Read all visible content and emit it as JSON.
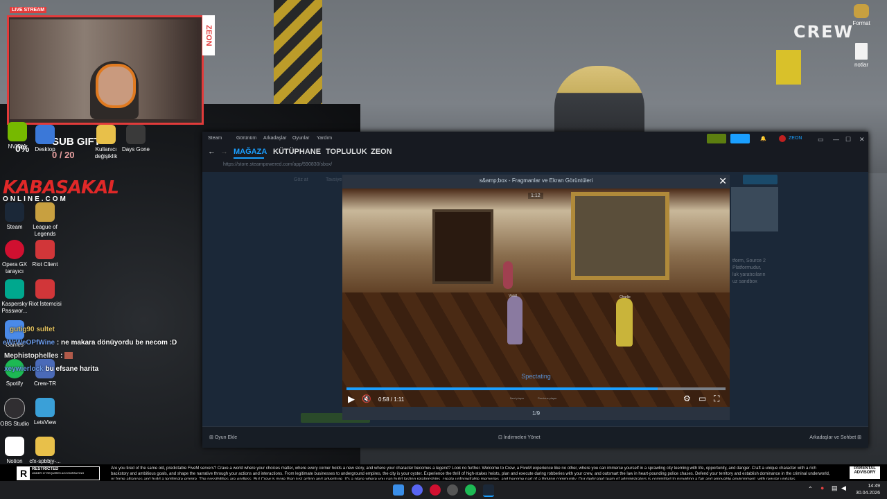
{
  "overlay": {
    "live_stream": "LIVE STREAM",
    "zeon_vertical": "ZEON",
    "percent": "0%",
    "sub_gift": "SUB GIFT",
    "gift_count": "0 / 20",
    "kabasakal": "KABASAKAL",
    "online": "ONLINE.COM",
    "crew_logo": "CREW"
  },
  "desktop_icons": [
    {
      "label": "NVIDIA",
      "color": "#76b900"
    },
    {
      "label": "Desktop",
      "color": "#3b78d8"
    },
    {
      "label": "Kullanıcı değişiklik",
      "color": "#e8c04a"
    },
    {
      "label": "Days Gone",
      "color": "#3a3a3a"
    },
    {
      "label": "Steam",
      "color": "#1b2838"
    },
    {
      "label": "League of Legends",
      "color": "#c8a040"
    },
    {
      "label": "Opera GX tarayıcı",
      "color": "#d01030"
    },
    {
      "label": "Riot Client",
      "color": "#d13639"
    },
    {
      "label": "Kaspersky Passwor...",
      "color": "#00a88e"
    },
    {
      "label": "Riot İstemcisi",
      "color": "#d13639"
    },
    {
      "label": "Games",
      "color": "#4a8ae8"
    },
    {
      "label": "Spotify",
      "color": "#1db954"
    },
    {
      "label": "Crew-TR",
      "color": "#4a6ab8"
    },
    {
      "label": "OBS Studio",
      "color": "#302e31"
    },
    {
      "label": "LetsView",
      "color": "#3aa0d8"
    },
    {
      "label": "Notion",
      "color": "#ffffff"
    },
    {
      "label": "cfx-spbbjy-...",
      "color": "#e8c04a"
    }
  ],
  "right_icons": [
    {
      "label": "Format"
    },
    {
      "label": "notlar"
    }
  ],
  "chat": [
    {
      "user": "gutig90 sultet",
      "message": ""
    },
    {
      "user": "eWrWeOPfWine",
      "message": ": ne makara dönüyordu be necom :D"
    },
    {
      "user": "Mephistophelles",
      "message": ":"
    },
    {
      "user": "xeywierlock",
      "message": "bu efsane harita"
    }
  ],
  "steam": {
    "menu": [
      "Steam",
      "Görünüm",
      "Arkadaşlar",
      "Oyunlar",
      "Yardım"
    ],
    "user": "ZEON",
    "tabs": [
      "MAĞAZA",
      "KÜTÜPHANE",
      "TOPLULUK",
      "ZEON"
    ],
    "url": "https://store.steampowered.com/app/590830/sbox/",
    "store_menu": [
      "Göz at",
      "Tavsiye"
    ],
    "sidebar_text": "tform, Source 2\nPlatformudur,\nluk yaratıcıların\nuz sandbox",
    "bottom_left": "Oyun Ekle",
    "bottom_center": "İndirmeleri Yönet",
    "bottom_right": "Arkadaşlar ve Sohbet"
  },
  "modal": {
    "title": "s&amp;box - Fragmanlar ve Ekran Görüntüleri",
    "video_badge": "1:12",
    "spectating": "Spectating",
    "label_player1": "Vaniil",
    "label_player2": "Charlie",
    "time": "0:58 / 1:11",
    "progress": 0.82,
    "page": "1/9",
    "hint1": "Next player",
    "hint2": "Previous player"
  },
  "promo": {
    "text": "Are you tired of the same old, predictable FiveM servers? Crave a world where your choices matter, where every corner holds a new story, and where your character becomes a legend? Look no further. Welcome to Crew, a FiveM experience like no other, where you can immerse yourself in a sprawling city teeming with life, opportunity, and danger. Craft a unique character with a rich backstory and ambitious goals, and shape the narrative through your actions and interactions. From legitimate businesses to underground empires, the city is your oyster. Experience the thrill of high-stakes heists, plan and execute daring robberies with your crew, and outsmart the law in heart-pounding police chases. Defend your territory and establish dominance in the criminal underworld, or forge alliances and build a legitimate empire. The possibilities are endless. But Crew is more than just action and adventure. It's a place where you can build lasting relationships, create unforgettable memories, and become part of a thriving community. Our dedicated team of administrators is committed to providing a fair and enjoyable environment, with regular updates",
    "rating_top": "RESTRICTED",
    "rating_bottom": "UNDER 17 REQUIRES ACCOMPANYING",
    "advisory": "PARENTAL ADVISORY"
  },
  "clock": {
    "time": "14:49",
    "date": "30.04.2026"
  }
}
